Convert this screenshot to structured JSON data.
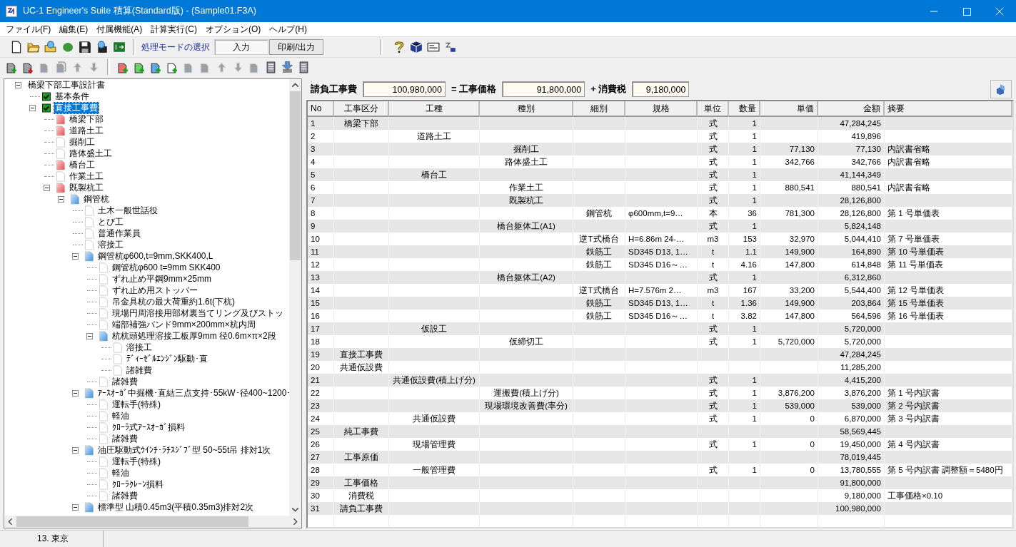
{
  "window": {
    "title": "UC-1 Engineer's Suite 積算(Standard版) - (Sample01.F3A)"
  },
  "menu": [
    "ファイル(F)",
    "編集(E)",
    "付属機能(A)",
    "計算実行(C)",
    "オプション(O)",
    "ヘルプ(H)"
  ],
  "toolbar": {
    "files": [
      {
        "kind": "new"
      },
      {
        "kind": "open"
      },
      {
        "kind": "open-web"
      },
      {
        "kind": "blob"
      },
      {
        "kind": "save"
      },
      {
        "kind": "save-web"
      },
      {
        "kind": "exit"
      }
    ],
    "mode_label": "処理モードの選択",
    "mode_tabs": [
      {
        "label": "入力",
        "selected": true
      },
      {
        "label": "印刷/出力",
        "selected": false
      }
    ],
    "help": [
      {
        "kind": "help"
      },
      {
        "kind": "cube"
      },
      {
        "kind": "card"
      },
      {
        "kind": "logo"
      }
    ]
  },
  "edit_toolbar": {
    "left": [
      {
        "kind": "page-add",
        "color": "#9aa0a8",
        "disabled": false
      },
      {
        "kind": "page-remove",
        "color": "#9aa0a8",
        "disabled": false
      },
      {
        "kind": "page",
        "color": "#9aa0a8",
        "disabled": true
      },
      {
        "kind": "pages",
        "color": "#9aa0a8",
        "disabled": true
      },
      {
        "kind": "up",
        "color": "#9aa0a8",
        "disabled": true
      },
      {
        "kind": "down",
        "color": "#9aa0a8",
        "disabled": true
      }
    ],
    "right": [
      {
        "kind": "page-add",
        "color": "#f07070",
        "disabled": false
      },
      {
        "kind": "page-add",
        "color": "#6ccf6c",
        "disabled": false
      },
      {
        "kind": "page-add",
        "color": "#5aa8e8",
        "disabled": false
      },
      {
        "kind": "page-add",
        "color": "#ffffff",
        "disabled": false
      },
      {
        "kind": "page",
        "color": "#9aa0a8",
        "disabled": true
      },
      {
        "kind": "page",
        "color": "#9aa0a8",
        "disabled": true
      },
      {
        "kind": "up",
        "color": "#9aa0a8",
        "disabled": true
      },
      {
        "kind": "down",
        "color": "#9aa0a8",
        "disabled": true
      },
      {
        "kind": "page",
        "color": "#9aa0a8",
        "disabled": true
      },
      {
        "kind": "list",
        "color": "#9aa0a8",
        "disabled": false
      },
      {
        "kind": "install",
        "color": "#5a8fd0",
        "disabled": false
      },
      {
        "kind": "server",
        "color": "#9aa0a8",
        "disabled": false
      }
    ]
  },
  "tree": {
    "label": "橋梁下部工事設計書",
    "expanded": true,
    "selected": false,
    "children": [
      {
        "label": "基本条件",
        "kind": "check",
        "checked": true,
        "selected": false
      },
      {
        "label": "直接工事費",
        "kind": "check",
        "checked": true,
        "selected": true,
        "expanded": true,
        "children": [
          {
            "label": "橋梁下部",
            "kind": "red",
            "selected": false
          },
          {
            "label": "道路土工",
            "kind": "red",
            "selected": false
          },
          {
            "label": "掘削工",
            "kind": "doc",
            "selected": false
          },
          {
            "label": "路体盛土工",
            "kind": "doc",
            "selected": false
          },
          {
            "label": "橋台工",
            "kind": "red",
            "selected": false
          },
          {
            "label": "作業土工",
            "kind": "doc",
            "selected": false
          },
          {
            "label": "既製杭工",
            "kind": "red",
            "selected": false,
            "expanded": true,
            "children": [
              {
                "label": "鋼管杭",
                "kind": "blue",
                "selected": false,
                "expanded": true,
                "children": [
                  {
                    "label": "土木一般世話役",
                    "kind": "doc",
                    "selected": false
                  },
                  {
                    "label": "とび工",
                    "kind": "doc",
                    "selected": false
                  },
                  {
                    "label": "普通作業員",
                    "kind": "doc",
                    "selected": false
                  },
                  {
                    "label": "溶接工",
                    "kind": "doc",
                    "selected": false
                  },
                  {
                    "label": "鋼管杭φ600,t=9mm,SKK400,L",
                    "kind": "blue",
                    "selected": false,
                    "expanded": true,
                    "children": [
                      {
                        "label": "鋼管杭φ600 t=9mm SKK400",
                        "kind": "doc",
                        "selected": false
                      },
                      {
                        "label": "ずれ止め平鋼9mm×25mm",
                        "kind": "doc",
                        "selected": false
                      },
                      {
                        "label": "ずれ止め用ストッパー",
                        "kind": "doc",
                        "selected": false
                      },
                      {
                        "label": "吊金具杭の最大荷重約1.6t(下杭)",
                        "kind": "doc",
                        "selected": false
                      },
                      {
                        "label": "現場円周溶接用部材裏当てリング及びストッ",
                        "kind": "doc",
                        "selected": false
                      },
                      {
                        "label": "端部補強バンド9mm×200mm×杭内周",
                        "kind": "doc",
                        "selected": false
                      },
                      {
                        "label": "杭杭頭処理溶接工板厚9mm 径0.6m×π×2段",
                        "kind": "blue",
                        "selected": false,
                        "expanded": true,
                        "children": [
                          {
                            "label": "溶接工",
                            "kind": "doc",
                            "selected": false
                          },
                          {
                            "label": "ﾃﾞｨｰｾﾞﾙｴﾝｼﾞﾝ駆動･直",
                            "kind": "doc",
                            "selected": false
                          },
                          {
                            "label": "諸雑費",
                            "kind": "doc",
                            "selected": false
                          }
                        ]
                      },
                      {
                        "label": "諸雑費",
                        "kind": "doc",
                        "selected": false
                      }
                    ]
                  },
                  {
                    "label": "ｱｰｽｵｰｶﾞ中掘機･直結三点支持･55kW･径400~1200･",
                    "kind": "blue",
                    "selected": false,
                    "expanded": true,
                    "children": [
                      {
                        "label": "運転手(特殊)",
                        "kind": "doc",
                        "selected": false
                      },
                      {
                        "label": "軽油",
                        "kind": "doc",
                        "selected": false
                      },
                      {
                        "label": "ｸﾛｰﾗ式ｱｰｽｵｰｶﾞ損料",
                        "kind": "doc",
                        "selected": false
                      },
                      {
                        "label": "諸雑費",
                        "kind": "doc",
                        "selected": false
                      }
                    ]
                  },
                  {
                    "label": "油圧駆動式ｳｲﾝﾁ･ﾗﾁｽｼﾞﾌﾞ型 50~55t吊 排対1次",
                    "kind": "blue",
                    "selected": false,
                    "expanded": true,
                    "children": [
                      {
                        "label": "運転手(特殊)",
                        "kind": "doc",
                        "selected": false
                      },
                      {
                        "label": "軽油",
                        "kind": "doc",
                        "selected": false
                      },
                      {
                        "label": "ｸﾛｰﾗｸﾚｰﾝ損料",
                        "kind": "doc",
                        "selected": false
                      },
                      {
                        "label": "諸雑費",
                        "kind": "doc",
                        "selected": false
                      }
                    ]
                  },
                  {
                    "label": "標準型 山積0.45m3(平積0.35m3)排対2次",
                    "kind": "blue",
                    "selected": false,
                    "expanded": true
                  }
                ]
              }
            ]
          }
        ]
      }
    ]
  },
  "totals": [
    {
      "label": "請負工事費",
      "value": "100,980,000"
    },
    {
      "label": "= 工事価格",
      "value": "91,800,000"
    },
    {
      "label": "+ 消費税",
      "value": "9,180,000"
    }
  ],
  "table": {
    "columns": [
      "No",
      "工事区分",
      "工種",
      "種別",
      "細別",
      "規格",
      "単位",
      "数量",
      "単価",
      "金額",
      "摘要"
    ],
    "rows": [
      [
        "1",
        "橋梁下部",
        null,
        null,
        null,
        null,
        "式",
        "1",
        null,
        "47,284,245",
        null
      ],
      [
        "2",
        null,
        "道路土工",
        null,
        null,
        null,
        "式",
        "1",
        null,
        "419,896",
        null
      ],
      [
        "3",
        null,
        null,
        "掘削工",
        null,
        null,
        "式",
        "1",
        "77,130",
        "77,130",
        "内訳書省略"
      ],
      [
        "4",
        null,
        null,
        "路体盛土工",
        null,
        null,
        "式",
        "1",
        "342,766",
        "342,766",
        "内訳書省略"
      ],
      [
        "5",
        null,
        "橋台工",
        null,
        null,
        null,
        "式",
        "1",
        null,
        "41,144,349",
        null
      ],
      [
        "6",
        null,
        null,
        "作業土工",
        null,
        null,
        "式",
        "1",
        "880,541",
        "880,541",
        "内訳書省略"
      ],
      [
        "7",
        null,
        null,
        "既製杭工",
        null,
        null,
        "式",
        "1",
        null,
        "28,126,800",
        null
      ],
      [
        "8",
        null,
        null,
        null,
        "鋼管杭",
        "φ600mm,t=9…",
        "本",
        "36",
        "781,300",
        "28,126,800",
        "第 1 号単価表"
      ],
      [
        "9",
        null,
        null,
        "橋台躯体工(A1)",
        null,
        null,
        "式",
        "1",
        null,
        "5,824,148",
        null
      ],
      [
        "10",
        null,
        null,
        null,
        "逆T式橋台",
        "H=6.86m 24-…",
        "m3",
        "153",
        "32,970",
        "5,044,410",
        "第 7 号単価表"
      ],
      [
        "11",
        null,
        null,
        null,
        "鉄筋工",
        "SD345 D13, 1…",
        "t",
        "1.1",
        "149,900",
        "164,890",
        "第 10 号単価表"
      ],
      [
        "12",
        null,
        null,
        null,
        "鉄筋工",
        "SD345 D16～…",
        "t",
        "4.16",
        "147,800",
        "614,848",
        "第 11 号単価表"
      ],
      [
        "13",
        null,
        null,
        "橋台躯体工(A2)",
        null,
        null,
        "式",
        "1",
        null,
        "6,312,860",
        null
      ],
      [
        "14",
        null,
        null,
        null,
        "逆T式橋台",
        "H=7.576m 2…",
        "m3",
        "167",
        "33,200",
        "5,544,400",
        "第 12 号単価表"
      ],
      [
        "15",
        null,
        null,
        null,
        "鉄筋工",
        "SD345 D13, 1…",
        "t",
        "1.36",
        "149,900",
        "203,864",
        "第 15 号単価表"
      ],
      [
        "16",
        null,
        null,
        null,
        "鉄筋工",
        "SD345 D16～…",
        "t",
        "3.82",
        "147,800",
        "564,596",
        "第 16 号単価表"
      ],
      [
        "17",
        null,
        "仮設工",
        null,
        null,
        null,
        "式",
        "1",
        null,
        "5,720,000",
        null
      ],
      [
        "18",
        null,
        null,
        "仮締切工",
        null,
        null,
        "式",
        "1",
        "5,720,000",
        "5,720,000",
        null
      ],
      [
        "19",
        "直接工事費",
        null,
        null,
        null,
        null,
        null,
        null,
        null,
        "47,284,245",
        null
      ],
      [
        "20",
        "共通仮設費",
        null,
        null,
        null,
        null,
        null,
        null,
        null,
        "11,285,200",
        null
      ],
      [
        "21",
        null,
        "共通仮設費(積上げ分)",
        null,
        null,
        null,
        "式",
        "1",
        null,
        "4,415,200",
        null
      ],
      [
        "22",
        null,
        null,
        "運搬費(積上げ分)",
        null,
        null,
        "式",
        "1",
        "3,876,200",
        "3,876,200",
        "第 1 号内訳書"
      ],
      [
        "23",
        null,
        null,
        "現場環境改善費(率分)",
        null,
        null,
        "式",
        "1",
        "539,000",
        "539,000",
        "第 2 号内訳書"
      ],
      [
        "24",
        null,
        "共通仮設費",
        null,
        null,
        null,
        "式",
        "1",
        "0",
        "6,870,000",
        "第 3 号内訳書"
      ],
      [
        "25",
        "純工事費",
        null,
        null,
        null,
        null,
        null,
        null,
        null,
        "58,569,445",
        null
      ],
      [
        "26",
        null,
        "現場管理費",
        null,
        null,
        null,
        "式",
        "1",
        "0",
        "19,450,000",
        "第 4 号内訳書"
      ],
      [
        "27",
        "工事原価",
        null,
        null,
        null,
        null,
        null,
        null,
        null,
        "78,019,445",
        null
      ],
      [
        "28",
        null,
        "一般管理費",
        null,
        null,
        null,
        "式",
        "1",
        "0",
        "13,780,555",
        "第 5 号内訳書 調整額＝5480円"
      ],
      [
        "29",
        "工事価格",
        null,
        null,
        null,
        null,
        null,
        null,
        null,
        "91,800,000",
        null
      ],
      [
        "30",
        "消費税",
        null,
        null,
        null,
        null,
        null,
        null,
        null,
        "9,180,000",
        "工事価格×0.10"
      ],
      [
        "31",
        "請負工事費",
        null,
        null,
        null,
        null,
        null,
        null,
        null,
        "100,980,000",
        null
      ]
    ]
  },
  "status_bar": {
    "location": "13. 東京"
  }
}
